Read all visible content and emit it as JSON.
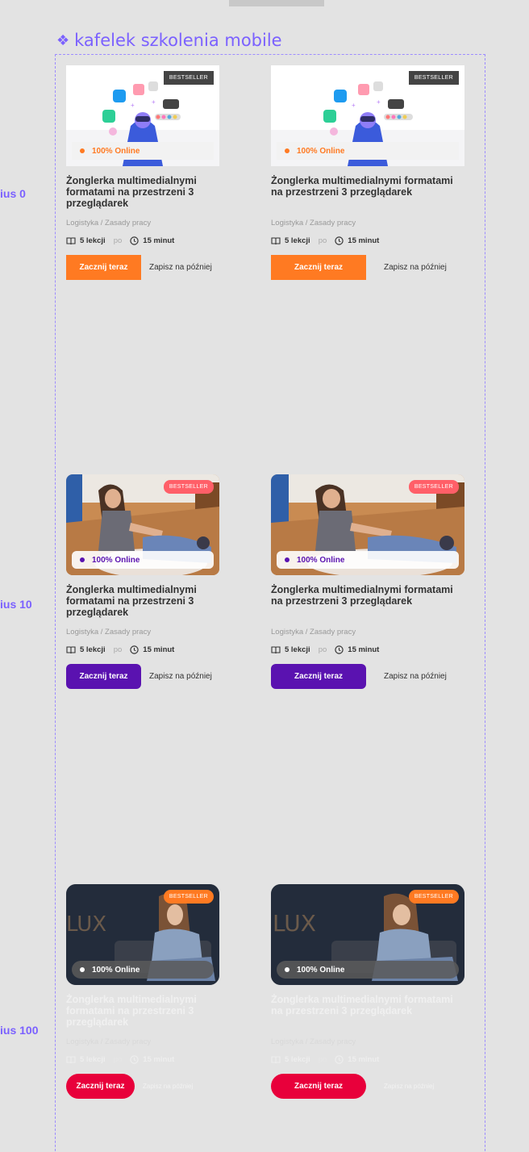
{
  "frame": {
    "title": "kafelek szkolenia mobile",
    "title_icon": "component-diamond-icon"
  },
  "variants": [
    {
      "label": "ius 0",
      "cards": [
        {
          "badge": "BESTSELLER",
          "online": "100% Online",
          "title": "Żonglerka multimedialnymi formatami na przestrzeni 3 przeglądarek",
          "category": "Logistyka / Zasady pracy",
          "lessons": "5 lekcji",
          "po": "po",
          "duration": "15 minut",
          "start": "Zacznij teraz",
          "later": "Zapisz na później"
        },
        {
          "badge": "BESTSELLER",
          "online": "100% Online",
          "title": "Żonglerka multimedialnymi formatami na przestrzeni 3 przeglądarek",
          "category": "Logistyka / Zasady pracy",
          "lessons": "5 lekcji",
          "po": "po",
          "duration": "15 minut",
          "start": "Zacznij teraz",
          "later": "Zapisz na później"
        }
      ]
    },
    {
      "label": "ius 10",
      "cards": [
        {
          "badge": "BESTSELLER",
          "online": "100% Online",
          "title": "Żonglerka multimedialnymi formatami na przestrzeni 3 przeglądarek",
          "category": "Logistyka / Zasady pracy",
          "lessons": "5 lekcji",
          "po": "po",
          "duration": "15 minut",
          "start": "Zacznij teraz",
          "later": "Zapisz na później"
        },
        {
          "badge": "BESTSELLER",
          "online": "100% Online",
          "title": "Żonglerka multimedialnymi formatami na przestrzeni 3 przeglądarek",
          "category": "Logistyka / Zasady pracy",
          "lessons": "5 lekcji",
          "po": "po",
          "duration": "15 minut",
          "start": "Zacznij teraz",
          "later": "Zapisz na później"
        }
      ]
    },
    {
      "label": "ius 100",
      "cards": [
        {
          "badge": "BESTSELLER",
          "online": "100% Online",
          "title": "Żonglerka multimedialnymi formatami na przestrzeni 3 przeglądarek",
          "category": "Logistyka / Zasady pracy",
          "lessons": "5 lekcji",
          "po": "po",
          "duration": "15 minut",
          "start": "Zacznij teraz",
          "later": "Zapisz na później"
        },
        {
          "badge": "BESTSELLER",
          "online": "100% Online",
          "title": "Żonglerka multimedialnymi formatami na przestrzeni 3 przeglądarek",
          "category": "Logistyka / Zasady pracy",
          "lessons": "5 lekcji",
          "po": "po",
          "duration": "15 minut",
          "start": "Zacznij teraz",
          "later": "Zapisz na później"
        }
      ]
    }
  ],
  "colors": {
    "frame_accent": "#7b61ff",
    "variant0_accent": "#ff7a22",
    "variant10_accent": "#5a12b0",
    "variant100_button": "#e8003b"
  },
  "icons": {
    "lessons": "book-icon",
    "duration": "clock-icon"
  }
}
